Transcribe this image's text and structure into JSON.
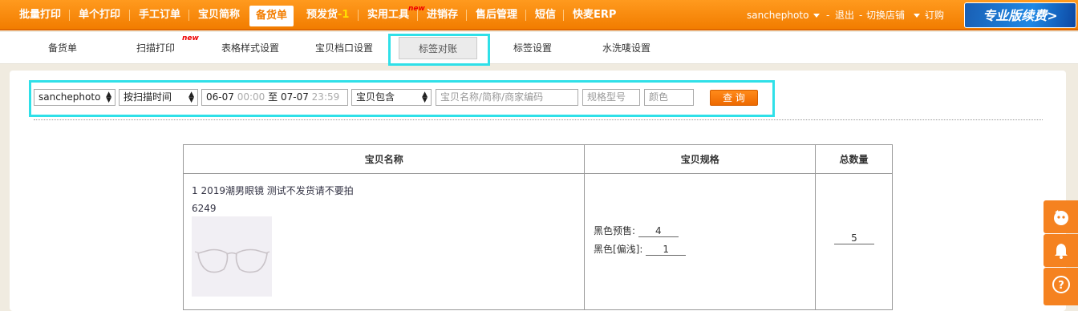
{
  "topnav": {
    "items": [
      "批量打印",
      "单个打印",
      "手工订单",
      "宝贝简称",
      "备货单",
      "预发货",
      "实用工具",
      "进销存",
      "售后管理",
      "短信",
      "快麦ERP"
    ],
    "presale_badge": "-1",
    "new_tag": "new",
    "user": "sanchephoto",
    "logout": "退出",
    "switch_shop": "切换店铺",
    "subscribe": "订购",
    "promo": "专业版续费>"
  },
  "subnav": {
    "tabs": [
      "备货单",
      "扫描打印",
      "表格样式设置",
      "宝贝档口设置",
      "标签对账",
      "标签设置",
      "水洗唛设置"
    ],
    "new_tag": "new",
    "active": "标签对账"
  },
  "filter": {
    "shop": "sanchephoto",
    "time_mode": "按扫描时间",
    "start_date": "06-07",
    "start_time": "00:00",
    "to": "至",
    "end_date": "07-07",
    "end_time": "23:59",
    "match_mode": "宝贝包含",
    "name_placeholder": "宝贝名称/简称/商家编码",
    "spec_placeholder": "规格型号",
    "color_placeholder": "颜色",
    "query": "查 询"
  },
  "table": {
    "headers": [
      "宝贝名称",
      "宝贝规格",
      "总数量"
    ],
    "rows": [
      {
        "name": "1 2019潮男眼镜 测试不发货请不要拍",
        "code": "6249",
        "specs": [
          {
            "label": "黑色预售:",
            "qty": "4"
          },
          {
            "label": "黑色[偏浅]:",
            "qty": "1"
          }
        ],
        "total": "5"
      }
    ]
  },
  "floating": [
    "chat-icon",
    "bell-icon",
    "help-icon"
  ],
  "colors": {
    "accent": "#f27d00",
    "highlight": "#2fe0e8",
    "brand_blue": "#1e88e5"
  }
}
